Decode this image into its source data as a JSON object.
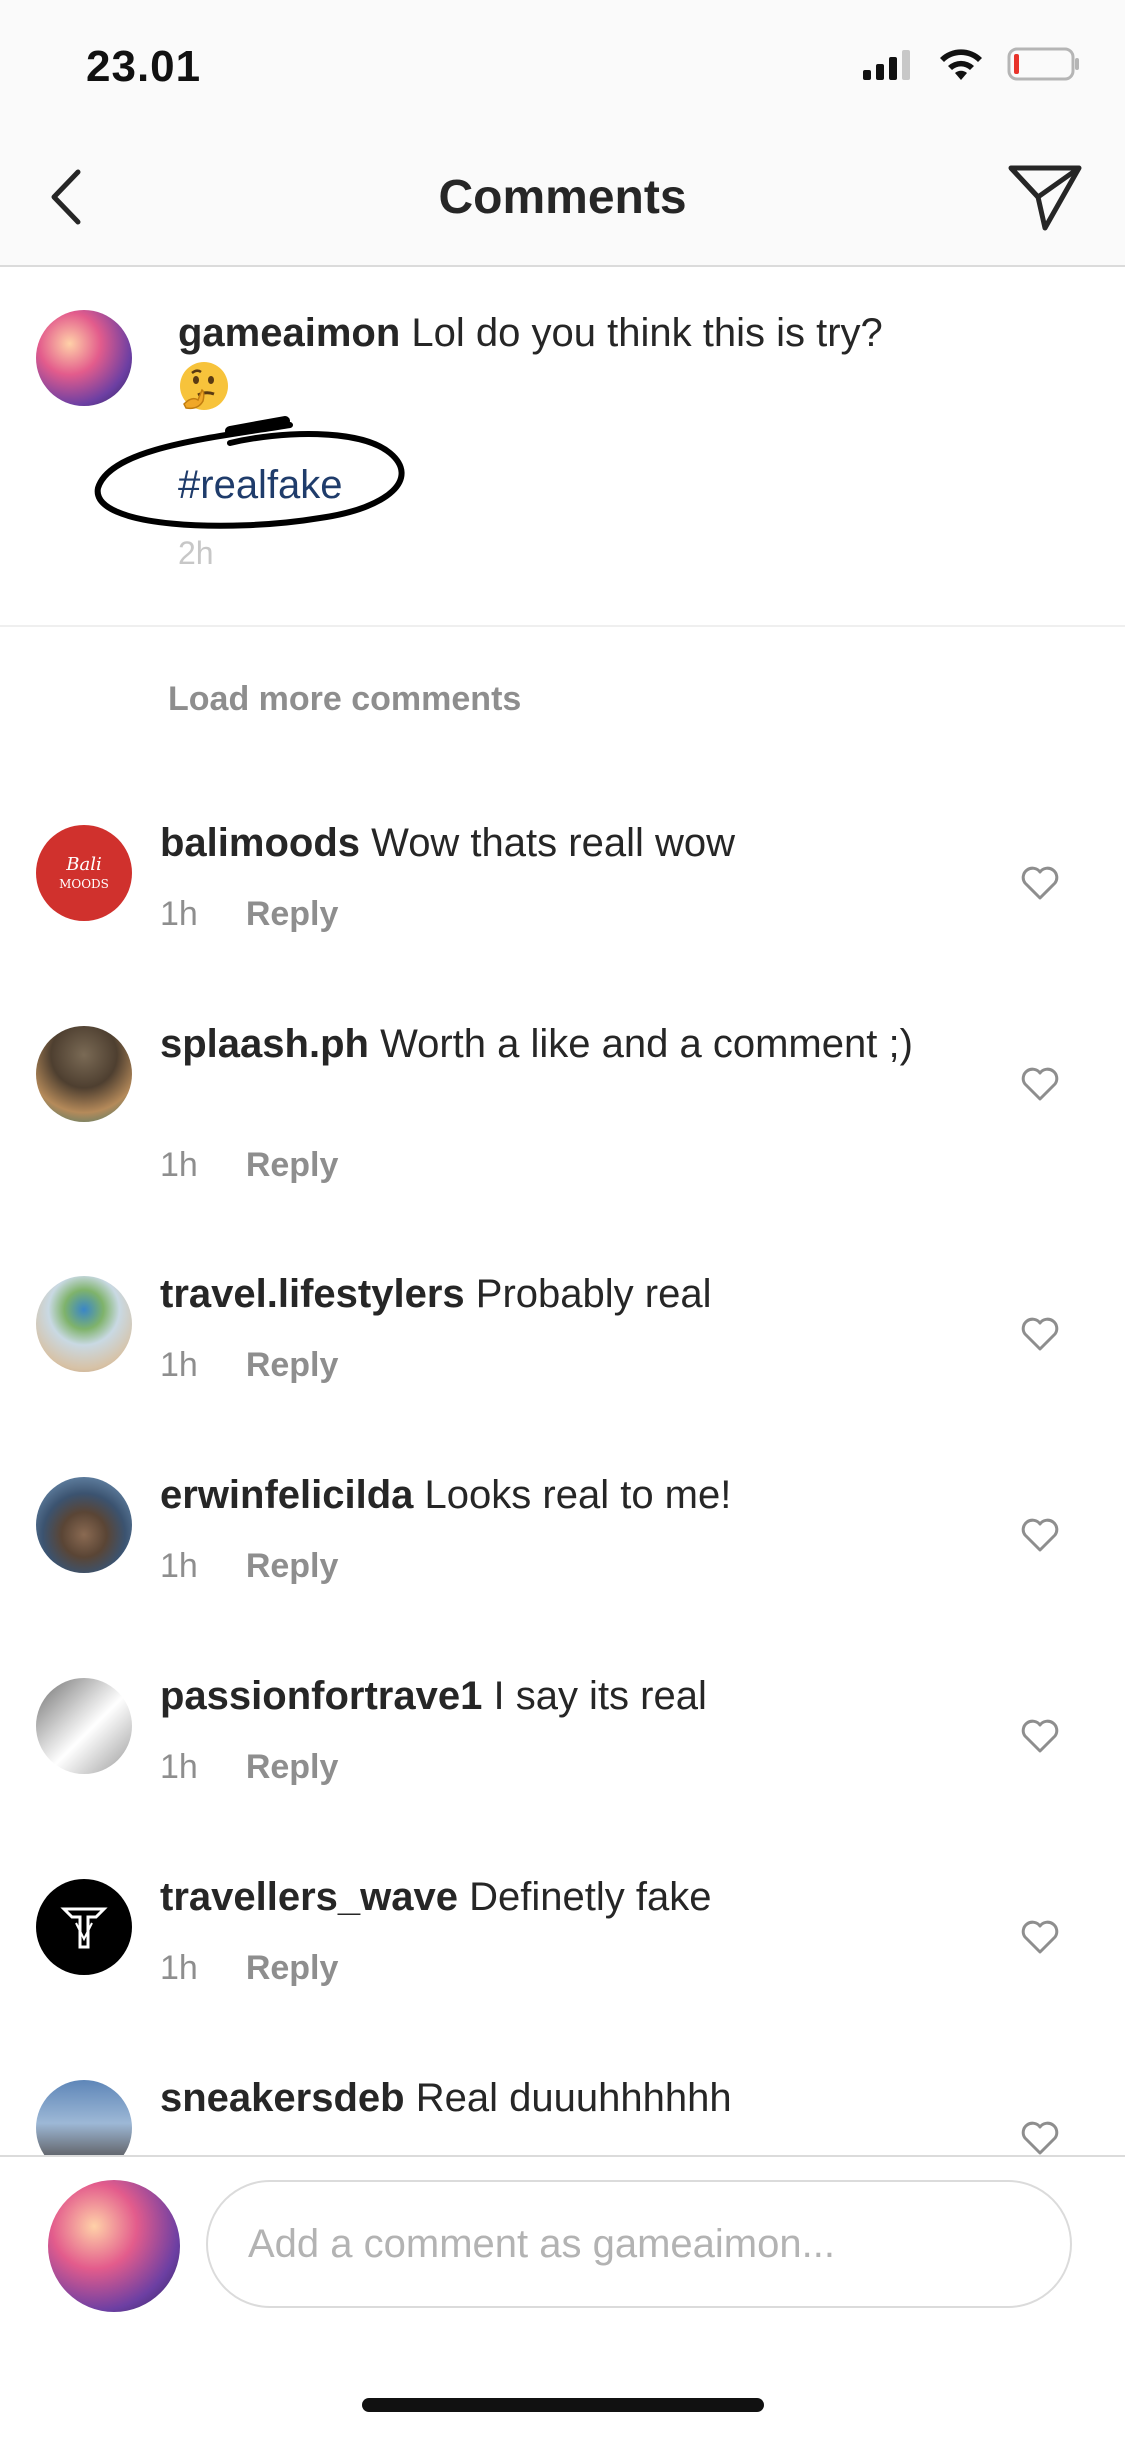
{
  "status": {
    "time": "23.01"
  },
  "header": {
    "title": "Comments"
  },
  "caption": {
    "username": "gameaimon",
    "text": "Lol do you think this is try?",
    "hashtag": "#realfake",
    "time": "2h"
  },
  "load_more": "Load more comments",
  "comments": [
    {
      "username": "balimoods",
      "text": "Wow thats reall wow",
      "time": "1h",
      "reply": "Reply",
      "avatar_color": "#d0312d"
    },
    {
      "username": "splaash.ph",
      "text": "Worth a like and a comment ;)",
      "time": "1h",
      "reply": "Reply",
      "avatar_color": "#6b5a43"
    },
    {
      "username": "travel.lifestylers",
      "text": "Probably real",
      "time": "1h",
      "reply": "Reply",
      "avatar_color": "#9fb9c9"
    },
    {
      "username": "erwinfelicilda",
      "text": "Looks real to me!",
      "time": "1h",
      "reply": "Reply",
      "avatar_color": "#3a4e63"
    },
    {
      "username": "passionfortrave1",
      "text": "I say its real",
      "time": "1h",
      "reply": "Reply",
      "avatar_color": "#8c8c8c"
    },
    {
      "username": "travellers_wave",
      "text": "Definetly fake",
      "time": "1h",
      "reply": "Reply",
      "avatar_color": "#000000"
    },
    {
      "username": "sneakersdeb",
      "text": "Real duuuhhhhhh",
      "time": "",
      "reply": "",
      "avatar_color": "#6f8fb3"
    }
  ],
  "input": {
    "placeholder": "Add a comment as gameaimon..."
  },
  "colors": {
    "link": "#1f3c6b",
    "muted": "#8e8e8e",
    "divider": "#dbdbdb"
  },
  "icons": [
    "back-chevron-icon",
    "send-paper-plane-icon",
    "heart-icon",
    "thinking-face-emoji",
    "signal-icon",
    "wifi-icon",
    "battery-icon"
  ]
}
